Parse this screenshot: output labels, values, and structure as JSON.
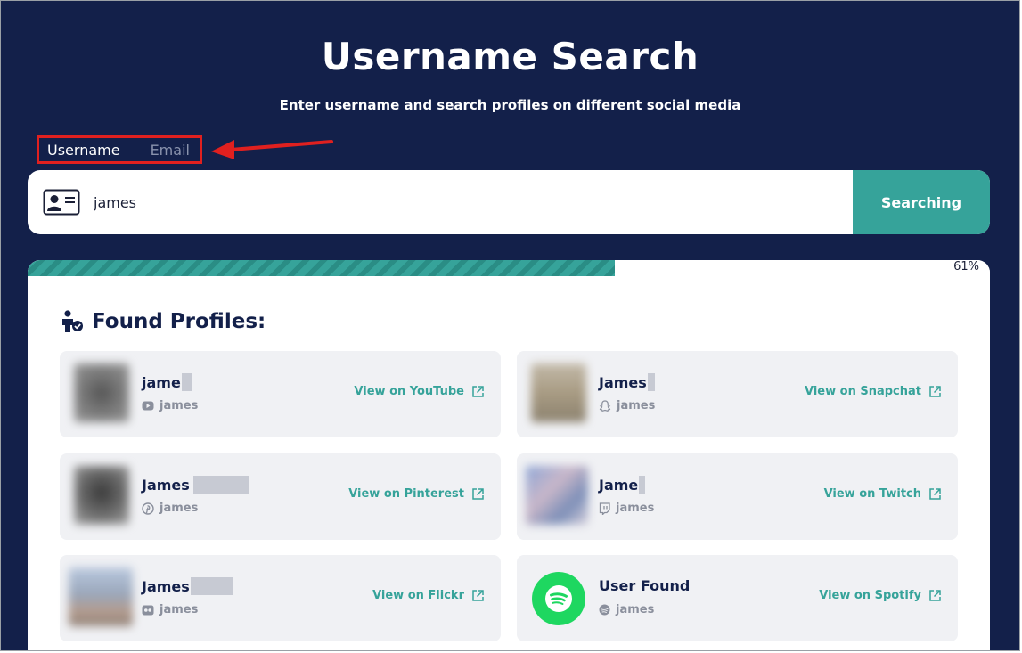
{
  "header": {
    "title": "Username Search",
    "subtitle": "Enter username and search profiles on different social media"
  },
  "mode_tabs": {
    "username": "Username",
    "email": "Email",
    "selected": "Username"
  },
  "search": {
    "value": "james",
    "button_label": "Searching"
  },
  "progress": {
    "percent": 61,
    "label": "61%"
  },
  "results": {
    "title": "Found Profiles:",
    "profiles": [
      {
        "name": "jame",
        "handle": "james",
        "platform": "YouTube",
        "link_label": "View on YouTube",
        "platform_icon": "youtube-icon",
        "redacted": true
      },
      {
        "name": "James",
        "handle": "james",
        "platform": "Snapchat",
        "link_label": "View on Snapchat",
        "platform_icon": "snapchat-icon",
        "redacted": true
      },
      {
        "name": "James",
        "handle": "james",
        "platform": "Pinterest",
        "link_label": "View on Pinterest",
        "platform_icon": "pinterest-icon",
        "redacted": true
      },
      {
        "name": "Jame",
        "handle": "james",
        "platform": "Twitch",
        "link_label": "View on Twitch",
        "platform_icon": "twitch-icon",
        "redacted": true
      },
      {
        "name": "James",
        "handle": "james",
        "platform": "Flickr",
        "link_label": "View on Flickr",
        "platform_icon": "flickr-icon",
        "redacted": true
      },
      {
        "name": "User Found",
        "handle": "james",
        "platform": "Spotify",
        "link_label": "View on Spotify",
        "platform_icon": "spotify-icon",
        "redacted": false
      }
    ]
  },
  "colors": {
    "background": "#13204a",
    "accent": "#36a39a",
    "highlight_box": "#e0201f",
    "card": "#f0f1f4",
    "spotify": "#1ed760"
  }
}
